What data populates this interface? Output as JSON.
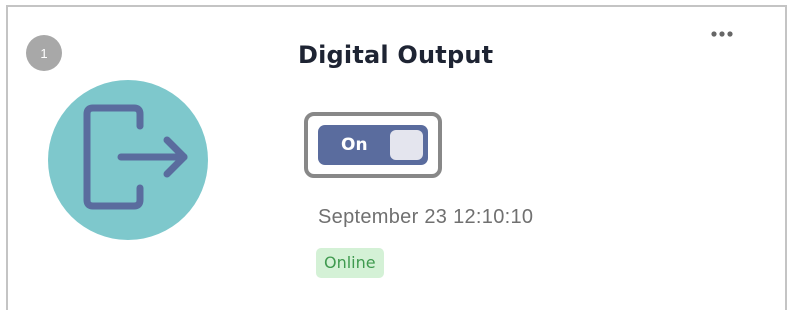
{
  "card": {
    "index": "1",
    "title": "Digital Output",
    "menu_icon": "more-horizontal-icon",
    "device_icon": "exit-arrow-icon",
    "device_icon_color": "#7ec8cc",
    "device_icon_stroke": "#5a6c9e",
    "toggle": {
      "label": "On",
      "state": "on",
      "track_color": "#5a6c9e"
    },
    "timestamp": "September 23 12:10:10",
    "status": {
      "label": "Online",
      "bg_color": "#d4f1d6",
      "text_color": "#3f9a4f"
    }
  }
}
